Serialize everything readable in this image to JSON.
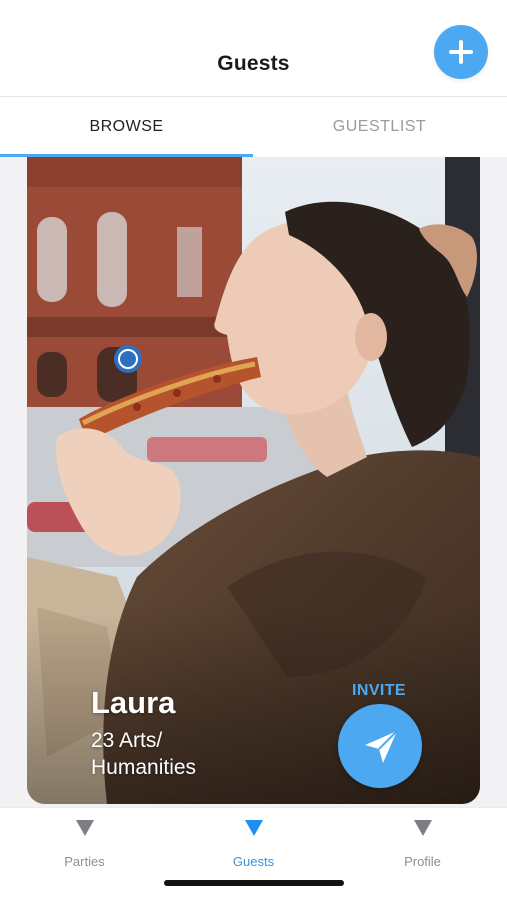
{
  "header": {
    "title": "Guests",
    "add_icon": "plus-icon"
  },
  "tabs": [
    {
      "label": "BROWSE",
      "active": true
    },
    {
      "label": "GUESTLIST",
      "active": false
    }
  ],
  "card": {
    "name": "Laura",
    "subtitle": "23 Arts/ Humanities",
    "invite_label": "INVITE",
    "invite_icon": "paper-plane-icon",
    "photo_description_icon": "profile-photo"
  },
  "bottom_nav": [
    {
      "label": "Parties",
      "icon": "triangle-down-icon",
      "active": false
    },
    {
      "label": "Guests",
      "icon": "triangle-down-icon",
      "active": true
    },
    {
      "label": "Profile",
      "icon": "triangle-down-icon",
      "active": false
    }
  ],
  "colors": {
    "accent": "#4ca8f0",
    "active_nav": "#3a93dd",
    "inactive_nav": "#8e8e93"
  }
}
